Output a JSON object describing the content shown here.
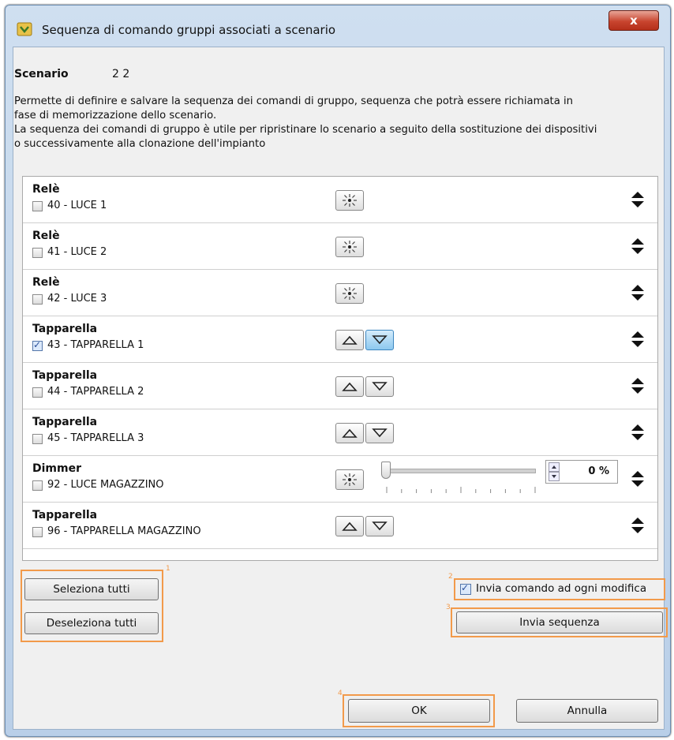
{
  "window": {
    "title": "Sequenza di comando gruppi associati a scenario",
    "close_label": "x"
  },
  "scenario": {
    "label": "Scenario",
    "value": "2 2"
  },
  "description": {
    "line1": "Permette di definire e salvare la sequenza dei comandi di gruppo, sequenza che potrà essere richiamata in",
    "line2": "fase di memorizzazione dello scenario.",
    "line3": "La sequenza dei comandi di gruppo è utile per ripristinare lo scenario a seguito della sostituzione dei dispositivi",
    "line4": "o successivamente alla clonazione dell'impianto"
  },
  "groups": [
    {
      "type": "Relè",
      "name": "40 - LUCE 1",
      "checked": false,
      "controls": "light"
    },
    {
      "type": "Relè",
      "name": "41 - LUCE 2",
      "checked": false,
      "controls": "light"
    },
    {
      "type": "Relè",
      "name": "42 - LUCE 3",
      "checked": false,
      "controls": "light"
    },
    {
      "type": "Tapparella",
      "name": "43 - TAPPARELLA 1",
      "checked": true,
      "controls": "shutter",
      "active": "down"
    },
    {
      "type": "Tapparella",
      "name": "44 - TAPPARELLA 2",
      "checked": false,
      "controls": "shutter"
    },
    {
      "type": "Tapparella",
      "name": "45 - TAPPARELLA 3",
      "checked": false,
      "controls": "shutter"
    },
    {
      "type": "Dimmer",
      "name": "92 - LUCE MAGAZZINO",
      "checked": false,
      "controls": "dimmer",
      "level": "0 %"
    },
    {
      "type": "Tapparella",
      "name": "96 - TAPPARELLA MAGAZZINO",
      "checked": false,
      "controls": "shutter"
    }
  ],
  "buttons": {
    "select_all": "Seleziona tutti",
    "deselect_all": "Deseleziona tutti",
    "send_each_change": "Invia comando ad ogni modifica",
    "send_sequence": "Invia sequenza",
    "ok": "OK",
    "cancel": "Annulla"
  },
  "callouts": {
    "n1": "1",
    "n2": "2",
    "n3": "3",
    "n4": "4"
  },
  "colors": {
    "highlight": "#f29a4a",
    "active_button": "#8cc8ef",
    "close_red": "#c8452f"
  }
}
